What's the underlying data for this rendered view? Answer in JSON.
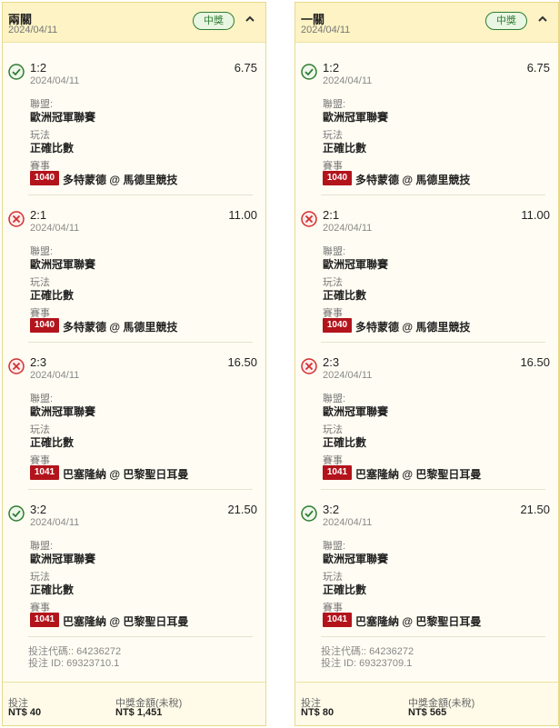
{
  "cards": [
    {
      "title": "兩關",
      "date": "2024/04/11",
      "status": "中獎",
      "bets": [
        {
          "result": "win",
          "score": "1:2",
          "odds": "6.75",
          "date": "2024/04/11",
          "league_label": "聯盟:",
          "league": "歐洲冠軍聯賽",
          "type_label": "玩法",
          "type": "正確比數",
          "match_label": "賽事",
          "match_id": "1040",
          "match": "多特蒙德 @ 馬德里競技"
        },
        {
          "result": "lose",
          "score": "2:1",
          "odds": "11.00",
          "date": "2024/04/11",
          "league_label": "聯盟:",
          "league": "歐洲冠軍聯賽",
          "type_label": "玩法",
          "type": "正確比數",
          "match_label": "賽事",
          "match_id": "1040",
          "match": "多特蒙德 @ 馬德里競技"
        },
        {
          "result": "lose",
          "score": "2:3",
          "odds": "16.50",
          "date": "2024/04/11",
          "league_label": "聯盟:",
          "league": "歐洲冠軍聯賽",
          "type_label": "玩法",
          "type": "正確比數",
          "match_label": "賽事",
          "match_id": "1041",
          "match": "巴塞隆納 @ 巴黎聖日耳曼"
        },
        {
          "result": "win",
          "score": "3:2",
          "odds": "21.50",
          "date": "2024/04/11",
          "league_label": "聯盟:",
          "league": "歐洲冠軍聯賽",
          "type_label": "玩法",
          "type": "正確比數",
          "match_label": "賽事",
          "match_id": "1041",
          "match": "巴塞隆納 @ 巴黎聖日耳曼"
        }
      ],
      "bet_code": "投注代碼:: 64236272",
      "bet_id": "投注 ID: 69323710.1",
      "stake_label": "投注",
      "stake": "NT$ 40",
      "payout_label": "中獎金額(未稅)",
      "payout": "NT$ 1,451"
    },
    {
      "title": "一關",
      "date": "2024/04/11",
      "status": "中獎",
      "bets": [
        {
          "result": "win",
          "score": "1:2",
          "odds": "6.75",
          "date": "2024/04/11",
          "league_label": "聯盟:",
          "league": "歐洲冠軍聯賽",
          "type_label": "玩法",
          "type": "正確比數",
          "match_label": "賽事",
          "match_id": "1040",
          "match": "多特蒙德 @ 馬德里競技"
        },
        {
          "result": "lose",
          "score": "2:1",
          "odds": "11.00",
          "date": "2024/04/11",
          "league_label": "聯盟:",
          "league": "歐洲冠軍聯賽",
          "type_label": "玩法",
          "type": "正確比數",
          "match_label": "賽事",
          "match_id": "1040",
          "match": "多特蒙德 @ 馬德里競技"
        },
        {
          "result": "lose",
          "score": "2:3",
          "odds": "16.50",
          "date": "2024/04/11",
          "league_label": "聯盟:",
          "league": "歐洲冠軍聯賽",
          "type_label": "玩法",
          "type": "正確比數",
          "match_label": "賽事",
          "match_id": "1041",
          "match": "巴塞隆納 @ 巴黎聖日耳曼"
        },
        {
          "result": "win",
          "score": "3:2",
          "odds": "21.50",
          "date": "2024/04/11",
          "league_label": "聯盟:",
          "league": "歐洲冠軍聯賽",
          "type_label": "玩法",
          "type": "正確比數",
          "match_label": "賽事",
          "match_id": "1041",
          "match": "巴塞隆納 @ 巴黎聖日耳曼"
        }
      ],
      "bet_code": "投注代碼:: 64236272",
      "bet_id": "投注 ID: 69323709.1",
      "stake_label": "投注",
      "stake": "NT$ 80",
      "payout_label": "中獎金額(未稅)",
      "payout": "NT$ 565"
    }
  ],
  "icons": {
    "win": "check-circle-icon",
    "lose": "x-circle-icon",
    "collapse": "chevron-up-icon"
  },
  "colors": {
    "win": "#2e7d32",
    "lose": "#d32f2f",
    "match_badge": "#b3141c",
    "header_bg": "#fdf3c4"
  }
}
